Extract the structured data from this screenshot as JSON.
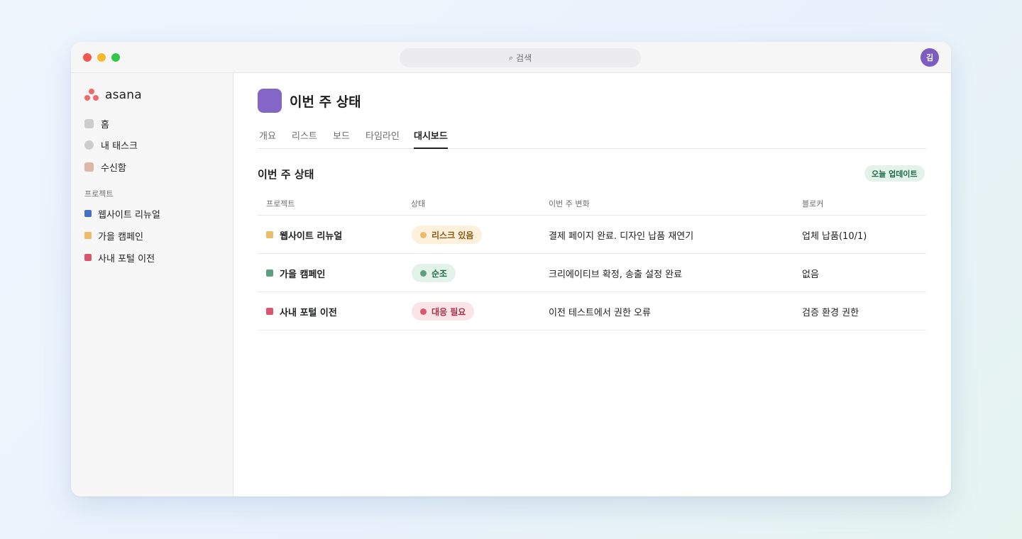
{
  "search": {
    "label": "검색",
    "icon": "search-icon"
  },
  "user": {
    "avatar_initial": "김"
  },
  "sidebar": {
    "logo_text": "asana",
    "nav": [
      {
        "label": "홈",
        "icon": "home-icon",
        "color": "#cdcdcf"
      },
      {
        "label": "내 태스크",
        "icon": "tasks-icon",
        "color": "#cdcdcf"
      },
      {
        "label": "수신함",
        "icon": "inbox-icon",
        "color": "#dab7a6"
      }
    ],
    "section_label": "프로젝트",
    "projects": [
      {
        "label": "웹사이트 리뉴얼",
        "color": "#4a6fc9"
      },
      {
        "label": "가을 캠페인",
        "color": "#ebbd6a"
      },
      {
        "label": "사내 포털 이전",
        "color": "#d9566c"
      }
    ]
  },
  "main": {
    "project_title": "이번 주 상태",
    "project_color": "#8466c7",
    "tabs": [
      {
        "label": "개요",
        "active": false
      },
      {
        "label": "리스트",
        "active": false
      },
      {
        "label": "보드",
        "active": false
      },
      {
        "label": "타임라인",
        "active": false
      },
      {
        "label": "대시보드",
        "active": true
      }
    ],
    "section_title": "이번 주 상태",
    "update_badge": "오늘 업데이트"
  },
  "table": {
    "headers": [
      "프로젝트",
      "상태",
      "이번 주 변화",
      "블로커"
    ],
    "rows": [
      {
        "project": "웹사이트 리뉴얼",
        "project_color": "#ebbd6a",
        "status": "리스크 있음",
        "status_bg": "#fdf0dc",
        "status_fg": "#8a5a12",
        "status_dot": "#ebbd6a",
        "change": "결제 페이지 완료. 디자인 납품 재연기",
        "blocker": "업체 납품(10/1)"
      },
      {
        "project": "가을 캠페인",
        "project_color": "#5e9e82",
        "status": "순조",
        "status_bg": "#e3f3ea",
        "status_fg": "#1f6b46",
        "status_dot": "#5e9e82",
        "change": "크리에이티브 확정, 송출 설정 완료",
        "blocker": "없음"
      },
      {
        "project": "사내 포털 이전",
        "project_color": "#d9566c",
        "status": "대응 필요",
        "status_bg": "#fbe4e8",
        "status_fg": "#a83248",
        "status_dot": "#d9566c",
        "change": "이전 테스트에서 권한 오류",
        "blocker": "검증 환경 권한"
      }
    ]
  }
}
